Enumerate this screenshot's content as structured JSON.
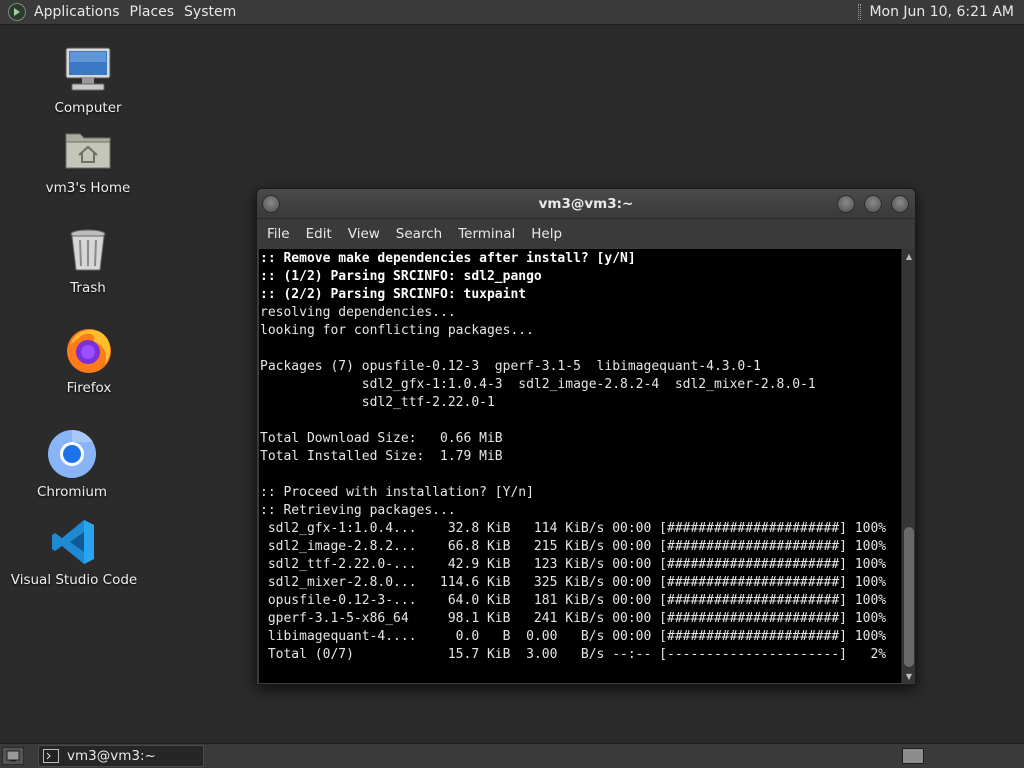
{
  "top_panel": {
    "menus": [
      "Applications",
      "Places",
      "System"
    ],
    "clock": "Mon Jun 10,  6:21 AM"
  },
  "desktop": {
    "icons": [
      {
        "label": "Computer",
        "icon": "computer-icon"
      },
      {
        "label": "vm3's Home",
        "icon": "home-folder-icon"
      },
      {
        "label": "Trash",
        "icon": "trash-icon"
      },
      {
        "label": "Firefox",
        "icon": "firefox-icon"
      },
      {
        "label": "Chromium",
        "icon": "chromium-icon"
      },
      {
        "label": "Visual Studio Code",
        "icon": "vscode-icon"
      }
    ]
  },
  "terminal": {
    "title": "vm3@vm3:~",
    "menu": [
      "File",
      "Edit",
      "View",
      "Search",
      "Terminal",
      "Help"
    ],
    "lines": [
      {
        "text": ":: Remove make dependencies after install? [y/N]",
        "bold": true
      },
      {
        "text": ":: (1/2) Parsing SRCINFO: sdl2_pango",
        "bold": true
      },
      {
        "text": ":: (2/2) Parsing SRCINFO: tuxpaint",
        "bold": true
      },
      {
        "text": "resolving dependencies...",
        "bold": false
      },
      {
        "text": "looking for conflicting packages...",
        "bold": false
      },
      {
        "text": "",
        "bold": false
      },
      {
        "text": "Packages (7) opusfile-0.12-3  gperf-3.1-5  libimagequant-4.3.0-1",
        "bold": false
      },
      {
        "text": "             sdl2_gfx-1:1.0.4-3  sdl2_image-2.8.2-4  sdl2_mixer-2.8.0-1",
        "bold": false
      },
      {
        "text": "             sdl2_ttf-2.22.0-1",
        "bold": false
      },
      {
        "text": "",
        "bold": false
      },
      {
        "text": "Total Download Size:   0.66 MiB",
        "bold": false
      },
      {
        "text": "Total Installed Size:  1.79 MiB",
        "bold": false
      },
      {
        "text": "",
        "bold": false
      },
      {
        "text": ":: Proceed with installation? [Y/n]",
        "bold": false
      },
      {
        "text": ":: Retrieving packages...",
        "bold": false
      },
      {
        "text": " sdl2_gfx-1:1.0.4...    32.8 KiB   114 KiB/s 00:00 [######################] 100%",
        "bold": false
      },
      {
        "text": " sdl2_image-2.8.2...    66.8 KiB   215 KiB/s 00:00 [######################] 100%",
        "bold": false
      },
      {
        "text": " sdl2_ttf-2.22.0-...    42.9 KiB   123 KiB/s 00:00 [######################] 100%",
        "bold": false
      },
      {
        "text": " sdl2_mixer-2.8.0...   114.6 KiB   325 KiB/s 00:00 [######################] 100%",
        "bold": false
      },
      {
        "text": " opusfile-0.12-3-...    64.0 KiB   181 KiB/s 00:00 [######################] 100%",
        "bold": false
      },
      {
        "text": " gperf-3.1-5-x86_64     98.1 KiB   241 KiB/s 00:00 [######################] 100%",
        "bold": false
      },
      {
        "text": " libimagequant-4....     0.0   B  0.00   B/s 00:00 [######################] 100%",
        "bold": false
      },
      {
        "text": " Total (0/7)            15.7 KiB  3.00   B/s --:-- [----------------------]   2%",
        "bold": false
      }
    ]
  },
  "taskbar": {
    "tasks": [
      "vm3@vm3:~"
    ]
  }
}
